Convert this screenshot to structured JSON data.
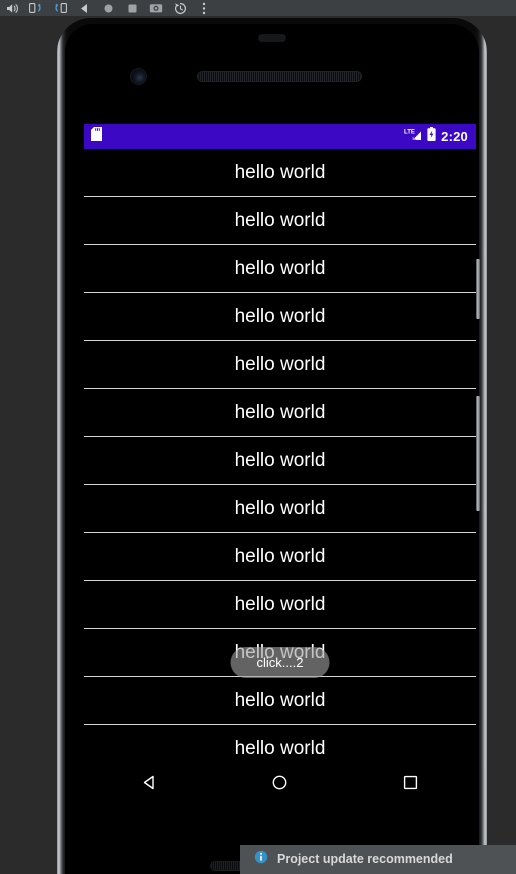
{
  "emulator_toolbar": {
    "buttons": [
      {
        "name": "volume-icon",
        "label": "Volume"
      },
      {
        "name": "rotate-left-icon",
        "label": "Rotate left"
      },
      {
        "name": "rotate-right-icon",
        "label": "Rotate right"
      },
      {
        "name": "back-icon",
        "label": "Back"
      },
      {
        "name": "home-icon",
        "label": "Home"
      },
      {
        "name": "overview-icon",
        "label": "Overview"
      },
      {
        "name": "screenshot-icon",
        "label": "Take screenshot"
      },
      {
        "name": "history-icon",
        "label": "Screen record / history"
      },
      {
        "name": "more-icon",
        "label": "More"
      }
    ]
  },
  "device": {
    "front_camera": "front-camera",
    "earpiece": "earpiece-speaker",
    "bottom_speaker": "bottom-speaker",
    "side_buttons": [
      "power-button",
      "volume-rocker"
    ]
  },
  "status_bar": {
    "background": "#3b08c4",
    "sd_card_icon": "sd-card-icon",
    "network": "LTE",
    "signal_icon": "signal-lte-icon",
    "battery_icon": "battery-charging-icon",
    "time": "2:20"
  },
  "list": {
    "item_label": "hello world",
    "items": [
      {
        "label": "hello world"
      },
      {
        "label": "hello world"
      },
      {
        "label": "hello world"
      },
      {
        "label": "hello world"
      },
      {
        "label": "hello world"
      },
      {
        "label": "hello world"
      },
      {
        "label": "hello world"
      },
      {
        "label": "hello world"
      },
      {
        "label": "hello world"
      },
      {
        "label": "hello world"
      },
      {
        "label": "hello world"
      },
      {
        "label": "hello world"
      },
      {
        "label": "hello world"
      }
    ]
  },
  "toast": {
    "message": "click....2"
  },
  "nav_bar": {
    "back": "back-triangle-icon",
    "home": "home-circle-icon",
    "recents": "recents-square-icon"
  },
  "ide_notification": {
    "icon": "info-icon",
    "icon_color": "#3592c4",
    "text": "Project update recommended"
  }
}
